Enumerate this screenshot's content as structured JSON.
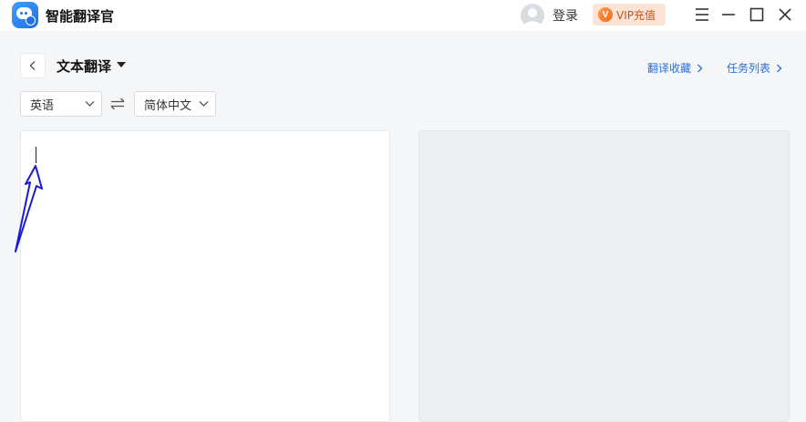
{
  "app": {
    "title": "智能翻译官"
  },
  "titlebar": {
    "login_label": "登录",
    "vip_badge": "V",
    "vip_label": "VIP充值"
  },
  "header": {
    "title": "文本翻译",
    "favorites_link": "翻译收藏",
    "tasks_link": "任务列表"
  },
  "languages": {
    "source": "英语",
    "target": "简体中文"
  },
  "editor": {
    "input_value": "",
    "output_value": ""
  },
  "colors": {
    "accent_link": "#2b6fd6",
    "vip_bg": "#fbe3d6",
    "annotation_arrow": "#1a1ad6"
  }
}
